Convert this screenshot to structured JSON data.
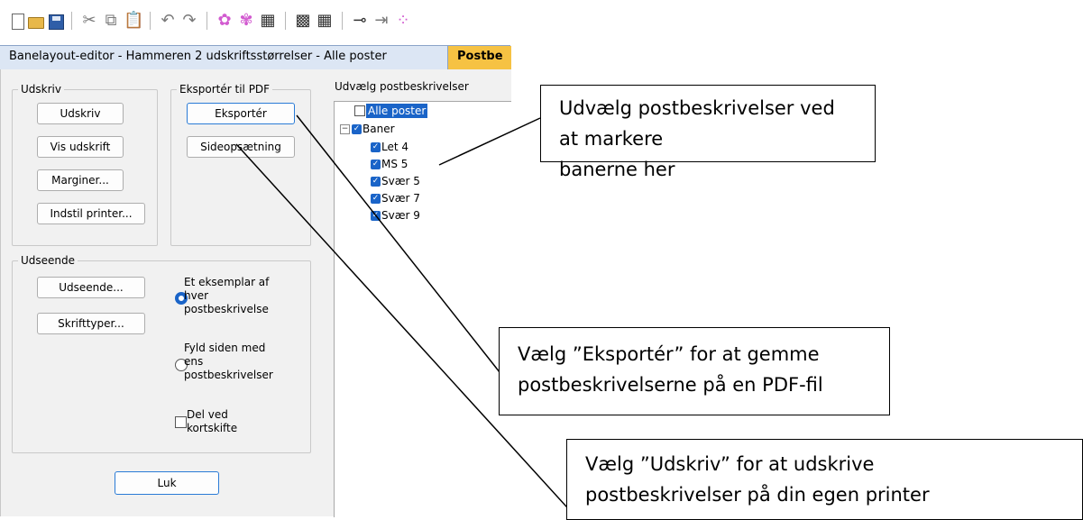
{
  "window": {
    "title": "Banelayout-editor - Hammeren 2 udskriftsstørrelser - Alle poster",
    "active_tab": "Postbe"
  },
  "toolbar": {
    "icons": [
      "new-icon",
      "open-icon",
      "save-icon",
      "cut-icon",
      "copy-icon",
      "paste-icon",
      "undo-icon",
      "redo-icon",
      "magic-icon",
      "magic2-icon",
      "table-icon",
      "grid-icon",
      "grid2-icon",
      "key-icon",
      "exit-icon",
      "more-icon"
    ]
  },
  "print_group": {
    "legend": "Udskriv",
    "buttons": {
      "print": "Udskriv",
      "preview": "Vis udskrift",
      "margins": "Marginer...",
      "printer": "Indstil printer..."
    }
  },
  "pdf_group": {
    "legend": "Eksportér til PDF",
    "buttons": {
      "export": "Eksportér",
      "page_setup": "Sideopsætning"
    }
  },
  "appearance_group": {
    "legend": "Udseende",
    "buttons": {
      "appearance": "Udseende...",
      "fonts": "Skrifttyper..."
    },
    "radio_one_copy": "Et eksemplar af\nhver\npostbeskrivelse",
    "radio_fill_page": "Fyld siden med\nens\npostbeskrivelser",
    "checkbox_split": "Del ved\nkortskifte"
  },
  "close_button": "Luk",
  "tree": {
    "legend": "Udvælg postbeskrivelser",
    "root_label": "Alle poster",
    "parent_label": "Baner",
    "expander": "−",
    "courses": [
      "Let 4",
      "MS 5",
      "Svær 5",
      "Svær 7",
      "Svær 9"
    ]
  },
  "callouts": {
    "select": "Udvælg postbeskrivelser ved at markere\nbanerne her",
    "export": "Vælg ”Eksportér” for at gemme\npostbeskrivelserne på en PDF-fil",
    "print": "Vælg ”Udskriv” for at udskrive\npostbeskrivelser på din egen printer"
  }
}
